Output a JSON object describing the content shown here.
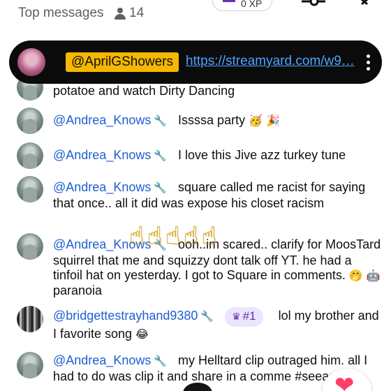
{
  "header": {
    "title": "Top messages",
    "viewer_count": "14",
    "xp_label": "0 XP"
  },
  "pinned_banner": {
    "username": "@AprilGShowers",
    "link": "https://streamyard.com/w9…"
  },
  "messages": [
    {
      "text": "potatoe and watch Dirty Dancing"
    },
    {
      "author": "@Andrea_Knows",
      "text": "Issssa party",
      "emojis": "🥳 🎉"
    },
    {
      "author": "@Andrea_Knows",
      "text": "I love this Jive azz turkey tune"
    },
    {
      "author": "@Andrea_Knows",
      "text": "square called me racist for saying that once.. all it did was expose his closet racism"
    },
    {
      "author": "@Andrea_Knows",
      "text": "ooh..im scared.. clarify for MoosTard squirrel that me and squizzy dont talk off YT. he had a tinfoil hat on yesterday. I got to Square in comments.",
      "emojis": "🤭 🤖",
      "text_end": "paranoia"
    },
    {
      "author": "@bridgettestrayhand9380",
      "badge": "#1",
      "text": "lol my brother and I favorite song",
      "emojis": "😂"
    },
    {
      "author": "@Andrea_Knows",
      "text": "my Helltard clip outraged him. all I had to do was clip it and share in a comme",
      "text_line3": "#seeasy"
    }
  ],
  "reaction_overlay": [
    "☝",
    "☝",
    "☝",
    "☝",
    "☝"
  ],
  "heart_icon": "❤",
  "colors": {
    "author": "#1f5fd0",
    "banner_bg": "#0b0b0b",
    "chip": "#f5b700",
    "link": "#4ea3ff",
    "badge_bg": "#ede4ff"
  }
}
